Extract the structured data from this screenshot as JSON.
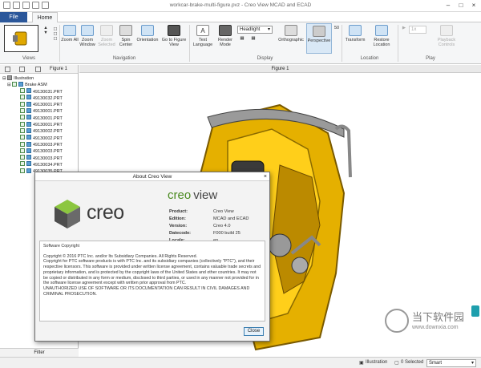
{
  "window": {
    "title": "workcar-brake-multi-figure.pvz - Creo View MCAD and ECAD"
  },
  "tabs": {
    "file": "File",
    "home": "Home"
  },
  "ribbon": {
    "views_label": "Views",
    "navigation_label": "Navigation",
    "display_label": "Display",
    "location_label": "Location",
    "play_label": "Play",
    "zoom_all": "Zoom All",
    "zoom_window": "Zoom Window",
    "zoom_selected": "Zoom Selected",
    "spin_center": "Spin Center",
    "orientation": "Orientation",
    "go_to_figure_view": "Go to Figure View",
    "text_language": "Text Language",
    "render_mode": "Render Mode",
    "headlight": "Headlight",
    "orthographic": "Orthographic",
    "perspective": "Perspective",
    "transform": "Transform",
    "restore_location": "Restore Location",
    "playback_controls": "Playback Controls",
    "play_value": "1x"
  },
  "left_panel": {
    "figure_tab": "Figure 1",
    "root": "Illustration",
    "assembly": "Brake ASM",
    "items": [
      "49130031.PRT",
      "49130032.PRT",
      "49130001.PRT",
      "49130001.PRT",
      "49130001.PRT",
      "49130001.PRT",
      "49130002.PRT",
      "49130002.PRT",
      "49130003.PRT",
      "49130003.PRT",
      "49130003.PRT",
      "49130034.PRT",
      "49130035.PRT"
    ],
    "filter": "Filter"
  },
  "viewport": {
    "tab": "Figure 1"
  },
  "dialog": {
    "title": "About Creo View",
    "close_x": "×",
    "brand": "creo",
    "product_brand": "creo",
    "product_word": "view",
    "labels": [
      "Product:",
      "Edition:",
      "Version:",
      "Datecode:",
      "Locale:"
    ],
    "values": [
      "Creo View",
      "MCAD and ECAD",
      "Creo 4.0",
      "F000 build 25",
      "en"
    ],
    "copyright_heading": "Software Copyright",
    "paragraph1": "Copyright © 2016 PTC Inc. and/or Its Subsidiary Companies. All Rights Reserved.",
    "paragraph2": "Copyright for PTC software products is with PTC Inc. and its subsidiary companies (collectively \"PTC\"), and their respective licensors. This software is provided under written license agreement, contains valuable trade secrets and proprietary information, and is protected by the copyright laws of the United States and other countries. It may not be copied or distributed in any form or medium, disclosed to third parties, or used in any manner not provided for in the software license agreement except with written prior approval from PTC.",
    "paragraph3": "UNAUTHORIZED USE OF SOFTWARE OR ITS DOCUMENTATION CAN RESULT IN CIVIL DAMAGES AND CRIMINAL PROSECUTION.",
    "close_button": "Close"
  },
  "status": {
    "illustration": "Illustration",
    "selected": "0 Selected",
    "mode": "Smart"
  },
  "watermark": {
    "name": "当下软件园",
    "url": "www.downxia.com"
  },
  "colors": {
    "accent": "#2b579a",
    "part": "#e0a800",
    "teal": "#1e9fad"
  }
}
